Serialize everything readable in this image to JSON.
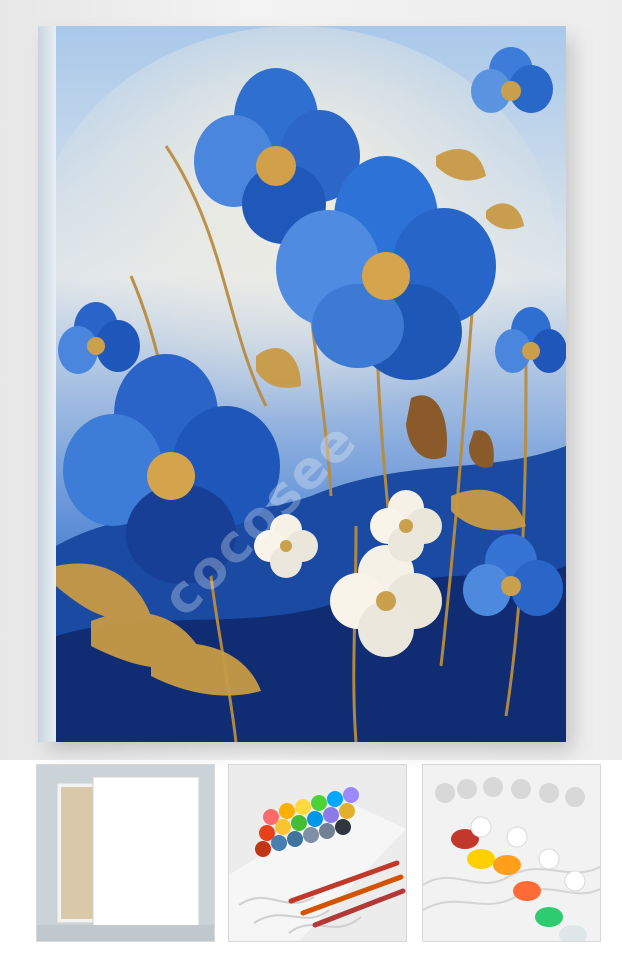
{
  "gallery": {
    "main_image": {
      "watermark": "cocosee"
    },
    "thumbnails": [
      {
        "name": "canvas-thumbnail"
      },
      {
        "name": "paint-kit-thumbnail"
      },
      {
        "name": "paint-pots-thumbnail"
      }
    ]
  },
  "colors": {
    "sky": "#8fb8e6",
    "cream": "#ede8dc",
    "blue": "#2f6fcf",
    "navy": "#173a8a",
    "gold": "#c89a45",
    "brown": "#8b5a2b",
    "white_flower": "#f5f1e7"
  }
}
